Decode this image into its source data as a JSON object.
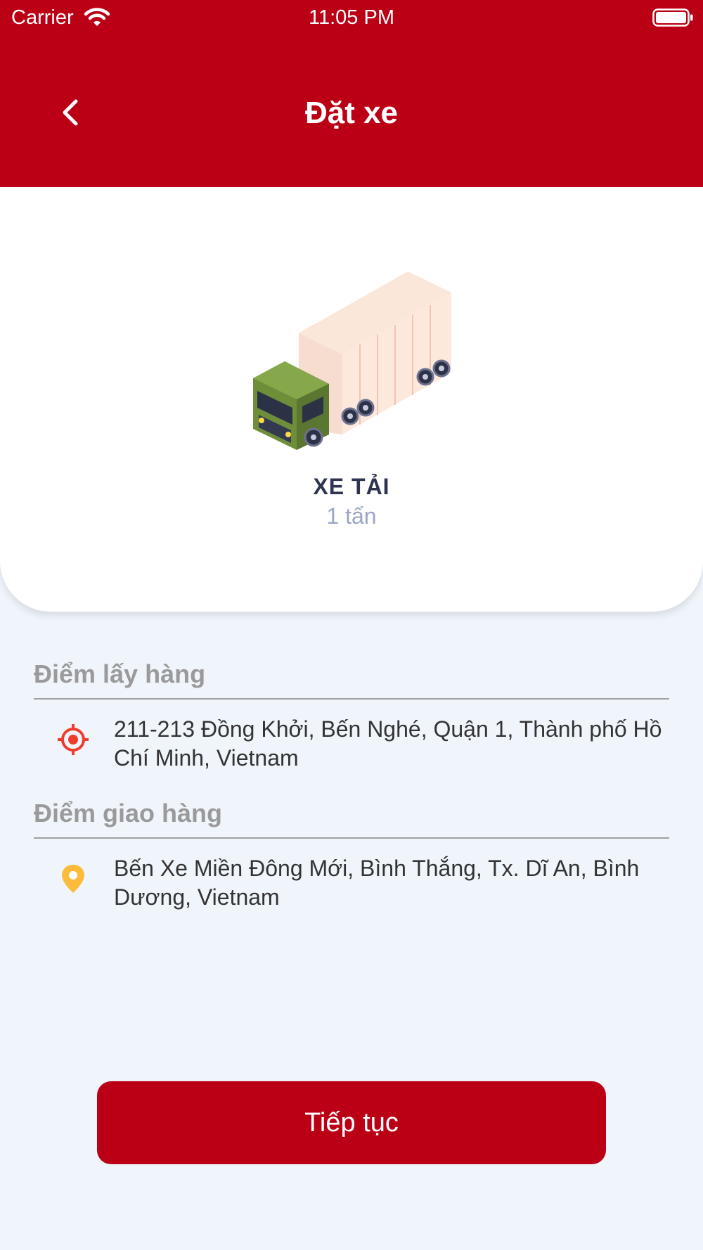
{
  "status_bar": {
    "carrier": "Carrier",
    "time": "11:05 PM"
  },
  "header": {
    "title": "Đặt xe",
    "back_icon": "chevron-left-icon",
    "background_color": "#bb0015"
  },
  "vehicle": {
    "name": "XE TẢI",
    "capacity": "1 tấn",
    "image": "truck-illustration"
  },
  "pickup": {
    "label": "Điểm lấy hàng",
    "address": "211-213 Đồng Khởi, Bến Nghé, Quận 1, Thành phố Hồ Chí Minh, Vietnam",
    "icon": "target-icon",
    "icon_color": "#f03c2e"
  },
  "dropoff": {
    "label": "Điểm giao hàng",
    "address": "Bến Xe Miền Đông Mới, Bình Thắng, Tx. Dĩ An, Bình Dương, Vietnam",
    "icon": "map-pin-icon",
    "icon_color": "#fbbc3b"
  },
  "actions": {
    "continue_label": "Tiếp tục"
  }
}
